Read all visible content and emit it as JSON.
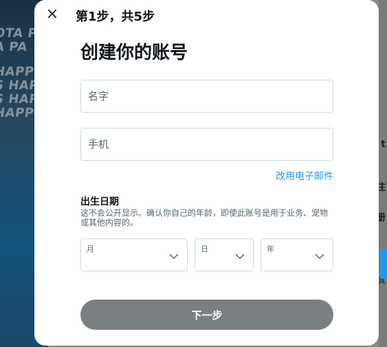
{
  "modal": {
    "step_label": "第1步，共5步",
    "title": "创建你的账号",
    "fields": {
      "name_placeholder": "名字",
      "phone_placeholder": "手机"
    },
    "use_email_link": "改用电子邮件",
    "dob": {
      "title": "出生日期",
      "description": "这不会公开显示。确认你自己的年龄，即使此账号是用于业务、宠物或其他内容的。",
      "month_label": "月",
      "day_label": "日",
      "year_label": "年"
    },
    "next_button": "下一步"
  },
  "background": {
    "left_texts": [
      "OTA PA",
      "A PA",
      "HAPP",
      "S HAPP",
      "S HAPP",
      "HAPP"
    ],
    "right_snippets": [
      "t",
      "注",
      "册",
      "其"
    ]
  },
  "colors": {
    "accent": "#1d9bf0",
    "text_primary": "#0f1419",
    "text_secondary": "#536471",
    "border": "#cfd9de",
    "button_disabled": "#7a7f82"
  },
  "icons": {
    "close": "close-icon",
    "chevron": "chevron-down-icon"
  }
}
